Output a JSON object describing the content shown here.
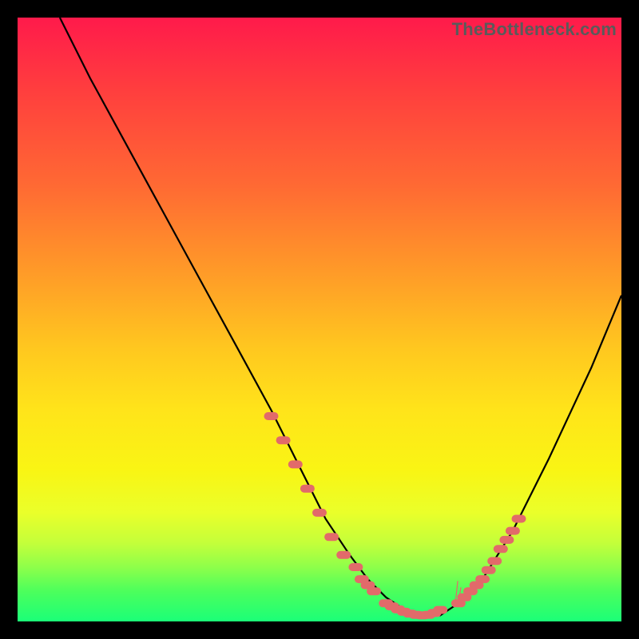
{
  "watermark": "TheBottleneck.com",
  "colors": {
    "curve_stroke": "#000000",
    "marker_fill": "#e26a6a",
    "marker_stroke": "#e26a6a",
    "background_black": "#000000"
  },
  "chart_data": {
    "type": "line",
    "title": "",
    "xlabel": "",
    "ylabel": "",
    "xlim": [
      0,
      100
    ],
    "ylim": [
      0,
      100
    ],
    "series": [
      {
        "name": "bottleneck-curve",
        "x": [
          7,
          12,
          18,
          24,
          30,
          36,
          42,
          47,
          51,
          55,
          58,
          61,
          64,
          67,
          70,
          73,
          77,
          82,
          88,
          95,
          100
        ],
        "y": [
          100,
          90,
          79,
          68,
          57,
          46,
          35,
          25,
          17,
          11,
          7,
          4,
          2,
          1,
          1,
          3,
          7,
          15,
          27,
          42,
          54
        ]
      }
    ],
    "markers_left": {
      "name": "left-cluster",
      "x": [
        42,
        44,
        46,
        48,
        50,
        52,
        54,
        56,
        57,
        58
      ],
      "y": [
        34,
        30,
        26,
        22,
        18,
        14,
        11,
        9,
        7,
        6
      ]
    },
    "markers_bottom": {
      "name": "bottom-cluster",
      "x": [
        59,
        61,
        62,
        63,
        64,
        65,
        66,
        67,
        68,
        69,
        70
      ],
      "y": [
        5,
        3,
        2.5,
        2,
        1.6,
        1.3,
        1.1,
        1.0,
        1.1,
        1.4,
        1.9
      ]
    },
    "markers_right": {
      "name": "right-cluster",
      "x": [
        73,
        74,
        75,
        76,
        77,
        78,
        79,
        80,
        81,
        82,
        83
      ],
      "y": [
        3,
        4,
        5,
        6,
        7,
        8.5,
        10,
        12,
        13.5,
        15,
        17
      ]
    }
  }
}
